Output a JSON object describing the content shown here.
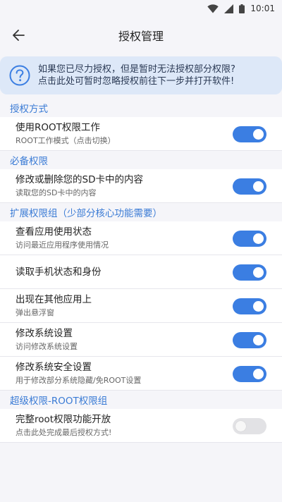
{
  "status": {
    "time": "10:01"
  },
  "header": {
    "title": "授权管理"
  },
  "notice": {
    "line1": "如果您已尽力授权，但是暂时无法授权部分权限?",
    "line2": "点击此处可暂时忽略授权前往下一步并打开软件!"
  },
  "sections": [
    {
      "title": "授权方式",
      "rows": [
        {
          "title": "使用ROOT权限工作",
          "subtitle": "ROOT工作模式（点击切换）",
          "on": true
        }
      ]
    },
    {
      "title": "必备权限",
      "rows": [
        {
          "title": "修改或删除您的SD卡中的内容",
          "subtitle": "读取您的SD卡中的内容",
          "on": true
        }
      ]
    },
    {
      "title": "扩展权限组（少部分核心功能需要）",
      "rows": [
        {
          "title": "查看应用使用状态",
          "subtitle": "访问最近应用程序使用情况",
          "on": true
        },
        {
          "title": "读取手机状态和身份",
          "subtitle": "",
          "on": true
        },
        {
          "title": "出现在其他应用上",
          "subtitle": "弹出悬浮窗",
          "on": true
        },
        {
          "title": "修改系统设置",
          "subtitle": "访问修改系统设置",
          "on": true
        },
        {
          "title": "修改系统安全设置",
          "subtitle": "用于修改部分系统隐藏/免ROOT设置",
          "on": true
        }
      ]
    },
    {
      "title": "超级权限-ROOT权限组",
      "rows": [
        {
          "title": "完整root权限功能开放",
          "subtitle": "点击此处完成最后授权方式!",
          "on": false
        }
      ]
    }
  ],
  "colors": {
    "accent": "#3b7ee2",
    "toggle_off": "#e2e2e5",
    "notice_bg": "#dde8f8"
  },
  "icons": {
    "back": "arrow-left-icon",
    "notice": "question-circle-icon"
  }
}
